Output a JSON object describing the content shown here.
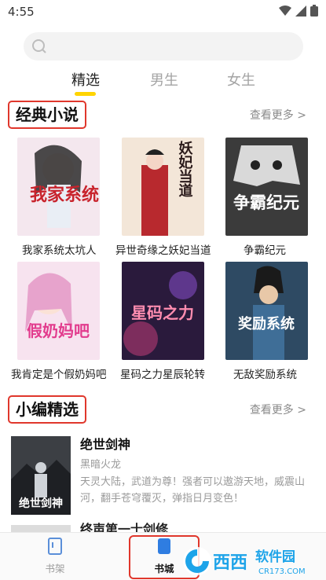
{
  "status_bar": {
    "time": "4:55"
  },
  "search": {
    "placeholder": ""
  },
  "tabs": [
    {
      "label": "精选",
      "active": true
    },
    {
      "label": "男生",
      "active": false
    },
    {
      "label": "女生",
      "active": false
    }
  ],
  "sections": {
    "classic": {
      "title": "经典小说",
      "more": "查看更多 >"
    },
    "editor": {
      "title": "小编精选",
      "more": "查看更多 >"
    }
  },
  "books": [
    {
      "title": "我家系统太坑人",
      "cover_text": "我家系统"
    },
    {
      "title": "异世奇缘之妖妃当道",
      "cover_text": "妖妃当道"
    },
    {
      "title": "争霸纪元",
      "cover_text": "争霸纪元"
    },
    {
      "title": "我肯定是个假奶妈吧",
      "cover_text": "假奶妈吧"
    },
    {
      "title": "星码之力星辰轮转",
      "cover_text": "星码之力"
    },
    {
      "title": "无敌奖励系统",
      "cover_text": "奖励系统"
    }
  ],
  "featured": {
    "title": "绝世剑神",
    "author": "黑暗火龙",
    "description": "天灵大陆，武道为尊！强者可以遨游天地，威震山河，翻手苍穹覆灭，弹指日月变色！",
    "cover_text": "绝世剑神"
  },
  "next_item_peek": "终声第一士剑修",
  "bottom_nav": [
    {
      "label": "书架",
      "icon": "bookshelf-icon",
      "active": false
    },
    {
      "label": "书城",
      "icon": "bookstore-icon",
      "active": true
    }
  ],
  "watermark": {
    "brand": "西西",
    "site": "软件园",
    "url": "CR173.COM"
  },
  "colors": {
    "accent_yellow": "#ffd400",
    "highlight_red": "#e0372c",
    "active_blue": "#2f7de1",
    "muted_text": "#9a9a9a"
  }
}
